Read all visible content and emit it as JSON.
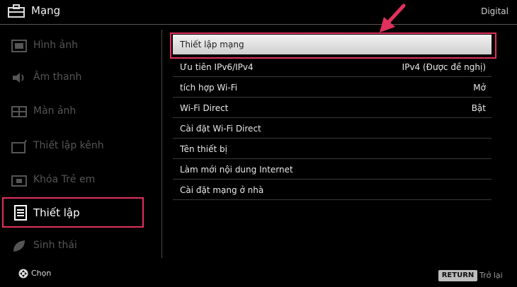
{
  "header": {
    "title": "Mạng",
    "mode": "Digital"
  },
  "sidebar": {
    "items": [
      {
        "label": "Hình ảnh",
        "icon": "picture-icon"
      },
      {
        "label": "Âm thanh",
        "icon": "speaker-icon"
      },
      {
        "label": "Màn ảnh",
        "icon": "screen-icon"
      },
      {
        "label": "Thiết lập kênh",
        "icon": "channel-setup-icon"
      },
      {
        "label": "Khóa Trẻ em",
        "icon": "lock-icon"
      },
      {
        "label": "Thiết lập",
        "icon": "settings-icon",
        "active": true
      },
      {
        "label": "Sinh thái",
        "icon": "eco-leaf-icon"
      }
    ]
  },
  "main": {
    "rows": [
      {
        "label": "Thiết lập mạng",
        "value": "",
        "selected": true
      },
      {
        "label": "Ưu tiên IPv6/IPv4",
        "value": "IPv4 (Được đề nghị)"
      },
      {
        "label": "tích hợp Wi-Fi",
        "value": "Mở"
      },
      {
        "label": "Wi-Fi Direct",
        "value": "Bật"
      },
      {
        "label": "Cài đặt Wi-Fi Direct",
        "value": ""
      },
      {
        "label": "Tên thiết bị",
        "value": ""
      },
      {
        "label": "Làm mới nội dung Internet",
        "value": ""
      },
      {
        "label": "Cài đặt mạng ở nhà",
        "value": ""
      }
    ]
  },
  "footer": {
    "select_label": "Chọn",
    "return_key": "RETURN",
    "return_label": "Trở lại"
  },
  "colors": {
    "highlight": "#e0315c",
    "background": "#000000",
    "inactive_text": "#555555"
  }
}
